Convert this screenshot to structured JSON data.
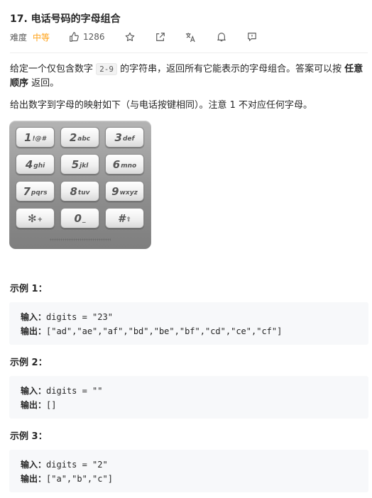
{
  "problem": {
    "title": "17. 电话号码的字母组合",
    "difficulty_label": "难度",
    "difficulty": "中等",
    "likes": "1286"
  },
  "description": {
    "p1_a": "给定一个仅包含数字 ",
    "p1_code": "2-9",
    "p1_b": " 的字符串，返回所有它能表示的字母组合。答案可以按 ",
    "p1_bold": "任意顺序",
    "p1_c": " 返回。",
    "p2": "给出数字到字母的映射如下（与电话按键相同）。注意 1 不对应任何字母。"
  },
  "keypad": {
    "keys": [
      {
        "n": "1",
        "l": "!@#"
      },
      {
        "n": "2",
        "l": "abc"
      },
      {
        "n": "3",
        "l": "def"
      },
      {
        "n": "4",
        "l": "ghi"
      },
      {
        "n": "5",
        "l": "jkl"
      },
      {
        "n": "6",
        "l": "mno"
      },
      {
        "n": "7",
        "l": "pqrs"
      },
      {
        "n": "8",
        "l": "tuv"
      },
      {
        "n": "9",
        "l": "wxyz"
      },
      {
        "n": "✻",
        "l": "+"
      },
      {
        "n": "0",
        "l": "_"
      },
      {
        "n": "#",
        "l": "⇧"
      }
    ]
  },
  "examples": [
    {
      "heading": "示例 1：",
      "input_label": "输入：",
      "input": "digits = \"23\"",
      "output_label": "输出：",
      "output": "[\"ad\",\"ae\",\"af\",\"bd\",\"be\",\"bf\",\"cd\",\"ce\",\"cf\"]"
    },
    {
      "heading": "示例 2：",
      "input_label": "输入：",
      "input": "digits = \"\"",
      "output_label": "输出：",
      "output": "[]"
    },
    {
      "heading": "示例 3：",
      "input_label": "输入：",
      "input": "digits = \"2\"",
      "output_label": "输出：",
      "output": "[\"a\",\"b\",\"c\"]"
    }
  ]
}
